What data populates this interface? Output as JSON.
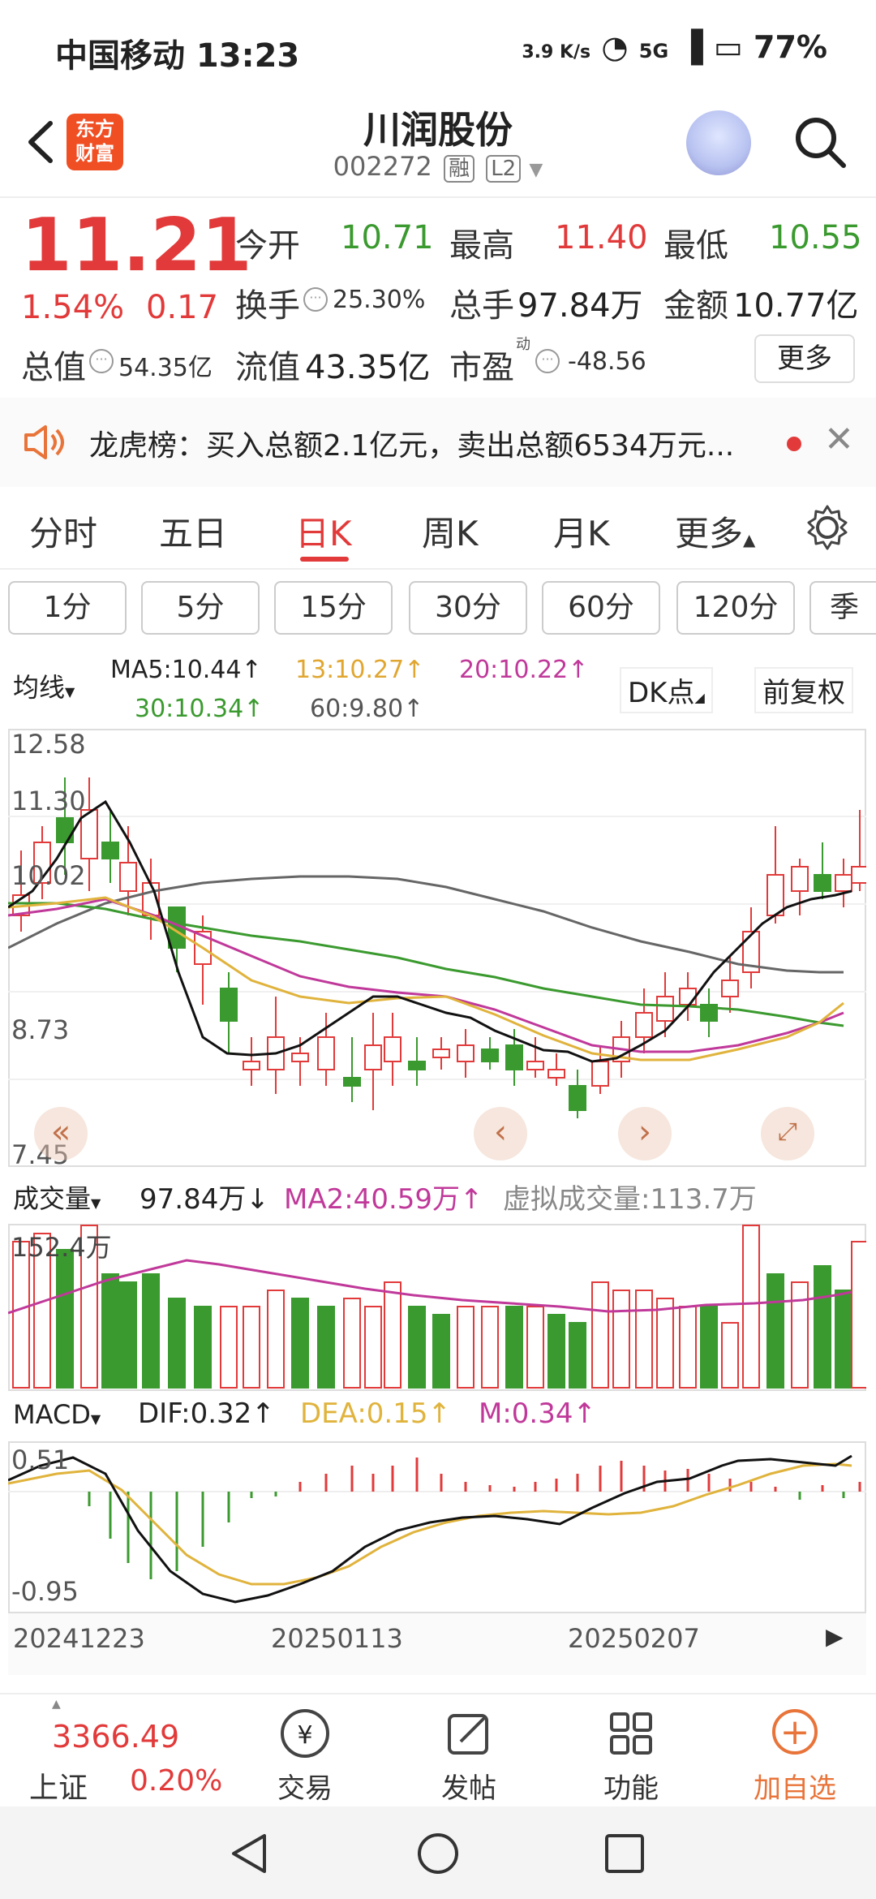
{
  "status_bar": {
    "carrier_time": "中国移动 13:23",
    "net_speed": "3.9 K/s",
    "network": "5G",
    "battery": "77%"
  },
  "header": {
    "title": "川润股份",
    "code": "002272",
    "tag_margin": "融",
    "tag_level": "L2",
    "logo_line1": "东方",
    "logo_line2": "财富"
  },
  "quote": {
    "price": "11.21",
    "change_pct": "1.54%",
    "change": "0.17",
    "open_label": "今开",
    "open": "10.71",
    "high_label": "最高",
    "high": "11.40",
    "low_label": "最低",
    "low": "10.55",
    "turnover_label": "换手",
    "turnover": "25.30%",
    "volume_label": "总手",
    "volume": "97.84万",
    "amount_label": "金额",
    "amount": "10.77亿",
    "mktcap_label": "总值",
    "mktcap": "54.35亿",
    "float_label": "流值",
    "float": "43.35亿",
    "pe_label": "市盈",
    "pe_sup": "动",
    "pe": "-48.56",
    "more": "更多"
  },
  "notice": {
    "text": "龙虎榜：买入总额2.1亿元，卖出总额6534万元..."
  },
  "tabs": [
    "分时",
    "五日",
    "日K",
    "周K",
    "月K",
    "更多"
  ],
  "active_tab": "日K",
  "periods": [
    "1分",
    "5分",
    "15分",
    "30分",
    "60分",
    "120分",
    "季"
  ],
  "ma_row": {
    "select": "均线",
    "ma5": "MA5:10.44↑",
    "ma13": "13:10.27↑",
    "ma20": "20:10.22↑",
    "ma30": "30:10.34↑",
    "ma60": "60:9.80↑",
    "dk": "DK点",
    "adjust": "前复权"
  },
  "price_axis": [
    "12.58",
    "11.30",
    "10.02",
    "8.73",
    "7.45"
  ],
  "volume_row": {
    "select": "成交量",
    "vol": "97.84万↓",
    "ma2": "MA2:40.59万↑",
    "virtual": "虚拟成交量:113.7万",
    "max": "152.4万"
  },
  "macd_row": {
    "select": "MACD",
    "dif": "DIF:0.32↑",
    "dea": "DEA:0.15↑",
    "m": "M:0.34↑",
    "top": "0.51",
    "bottom": "-0.95"
  },
  "dates": [
    "20241223",
    "20250113",
    "20250207"
  ],
  "bottom_nav": {
    "index_value": "3366.49",
    "index_name": "上证",
    "index_change": "0.20%",
    "trade": "交易",
    "post": "发帖",
    "func": "功能",
    "add": "加自选"
  },
  "colors": {
    "up": "#e23a3a",
    "down": "#3b9a2f",
    "ma5": "#222222",
    "ma13": "#e0b33c",
    "ma20": "#c0399a",
    "ma30": "#3b9a2f",
    "ma60": "#666666"
  }
}
